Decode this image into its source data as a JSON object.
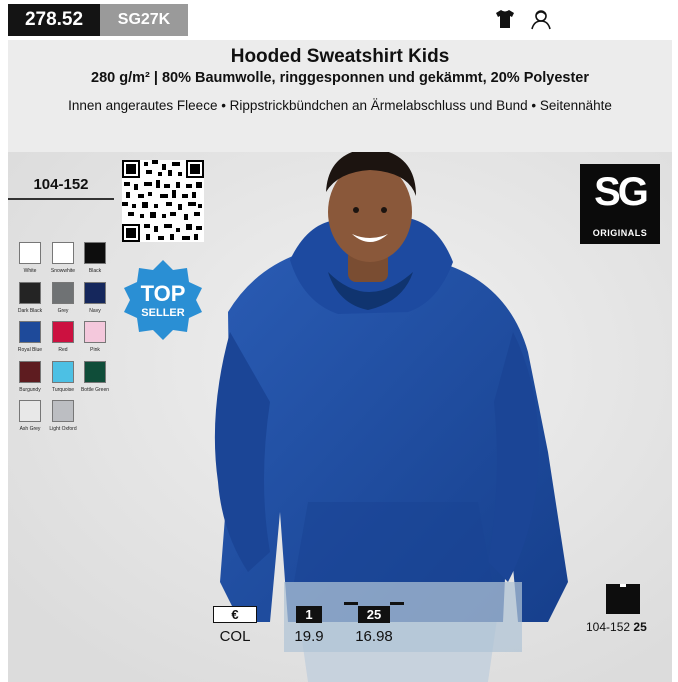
{
  "header": {
    "article_number": "278.52",
    "style_code": "SG27K",
    "title": "Hooded Sweatshirt Kids",
    "material": "280 g/m² | 80% Baumwolle, ringgesponnen und gekämmt, 20% Polyester",
    "features": "Innen angerautes Fleece • Rippstrickbündchen an Ärmelabschluss und Bund  • Seitennähte"
  },
  "icons": {
    "garment": "tshirt-icon",
    "fit": "kids-head-icon"
  },
  "sizes": {
    "range": "104-152"
  },
  "colors": [
    {
      "name": "White",
      "hex": "#ffffff"
    },
    {
      "name": "Snowwhite",
      "hex": "#ffffff"
    },
    {
      "name": "Black",
      "hex": "#0d0d0d"
    },
    {
      "name": "Dark Black",
      "hex": "#242424"
    },
    {
      "name": "Grey",
      "hex": "#6f7274"
    },
    {
      "name": "Navy",
      "hex": "#15275c"
    },
    {
      "name": "Royal Blue",
      "hex": "#1e4a9a"
    },
    {
      "name": "Red",
      "hex": "#cc1140"
    },
    {
      "name": "Pink",
      "hex": "#f4c8dc"
    },
    {
      "name": "Burgundy",
      "hex": "#5e1c20"
    },
    {
      "name": "Turquoise",
      "hex": "#4cc0e4"
    },
    {
      "name": "Bottle Green",
      "hex": "#0f4d39"
    },
    {
      "name": "Ash Grey",
      "hex": "#e8e8e8"
    },
    {
      "name": "Light Oxford",
      "hex": "#bcbec2"
    }
  ],
  "badge": {
    "line1": "TOP",
    "line2": "SELLER"
  },
  "brand": {
    "logo_text": "SG",
    "logo_sub": "ORIGINALS"
  },
  "pricing": {
    "currency": "€",
    "column_label": "COL",
    "tiers": [
      {
        "qty": "1",
        "price": "19.9"
      },
      {
        "qty": "25",
        "price": "16.98"
      }
    ]
  },
  "carton": {
    "sizes": "104-152",
    "qty": "25"
  },
  "palette": {
    "hoodie": "#1e4fa6",
    "label_black": "#141414",
    "label_grey": "#9a9a9a",
    "badge_blue": "#2a8fd4"
  }
}
